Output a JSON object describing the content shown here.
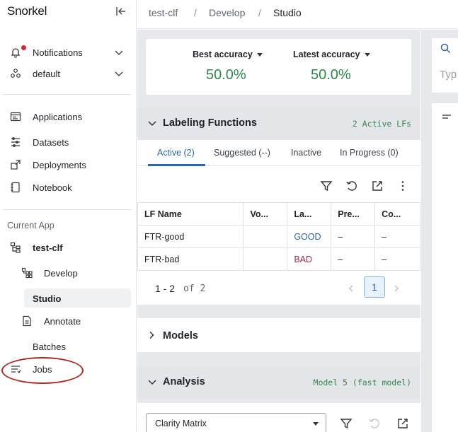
{
  "sidebar": {
    "brand": "Snorkel",
    "notifications": "Notifications",
    "workspace": "default",
    "nav": {
      "applications": "Applications",
      "datasets": "Datasets",
      "deployments": "Deployments",
      "notebook": "Notebook"
    },
    "current_app_label": "Current App",
    "app_name": "test-clf",
    "develop": "Develop",
    "studio": "Studio",
    "annotate": "Annotate",
    "batches": "Batches",
    "jobs": "Jobs"
  },
  "breadcrumb": {
    "items": [
      "test-clf",
      "Develop",
      "Studio"
    ],
    "separator": "/"
  },
  "accuracy": {
    "best_label": "Best accuracy",
    "best_value": "50.0%",
    "latest_label": "Latest accuracy",
    "latest_value": "50.0%"
  },
  "lf_section": {
    "title": "Labeling Functions",
    "meta": "2 Active LFs",
    "tabs": [
      "Active (2)",
      "Suggested (--)",
      "Inactive",
      "In Progress (0)"
    ],
    "columns": [
      "LF Name",
      "Vo...",
      "La...",
      "Pre...",
      "Co..."
    ],
    "rows": [
      {
        "name": "FTR-good",
        "vote": "",
        "label": "GOOD",
        "pre": "–",
        "co": "–"
      },
      {
        "name": "FTR-bad",
        "vote": "",
        "label": "BAD",
        "pre": "–",
        "co": "–"
      }
    ],
    "pager": {
      "range": "1 - 2",
      "of": "of 2",
      "page": "1"
    }
  },
  "models_section": {
    "title": "Models"
  },
  "analysis_section": {
    "title": "Analysis",
    "meta": "Model 5 (fast model)",
    "select_value": "Clarity Matrix"
  },
  "right_pane": {
    "placeholder": "Typ"
  },
  "colors": {
    "accent": "#2b64b5",
    "success": "#2c8a4a",
    "bad": "#a3274a",
    "alert": "#e0203a"
  }
}
